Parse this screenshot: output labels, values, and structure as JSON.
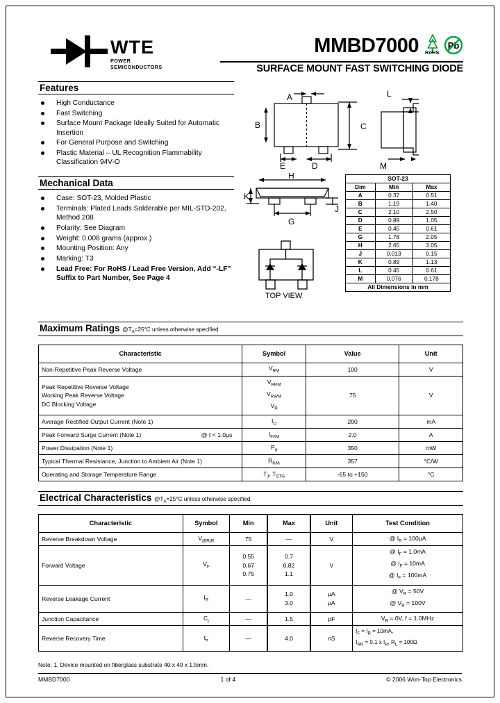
{
  "header": {
    "logo_text": "WTE",
    "logo_sub": "POWER SEMICONDUCTORS",
    "part_number": "MMBD7000",
    "rohs_label": "RoHS",
    "pb_label": "Pb",
    "subtitle": "SURFACE MOUNT FAST SWITCHING DIODE"
  },
  "features": {
    "title": "Features",
    "items": [
      "High Conductance",
      "Fast Switching",
      "Surface Mount Package Ideally Suited for Automatic Insertion",
      "For General Purpose and Switching",
      "Plastic Material – UL Recognition Flammability Classification 94V-O"
    ]
  },
  "mechanical": {
    "title": "Mechanical Data",
    "items": [
      "Case: SOT-23, Molded Plastic",
      "Terminals: Plated Leads Solderable per MIL-STD-202, Method 208",
      "Polarity: See Diagram",
      "Weight: 0.008 grams (approx.)",
      "Mounting Position: Any",
      "Marking: T3",
      "Lead Free: For RoHS / Lead Free Version, Add “-LF” Suffix to Part Number, See Page 4"
    ],
    "bold_index": 6
  },
  "package_diagram": {
    "labels": [
      "A",
      "B",
      "C",
      "D",
      "E",
      "G",
      "H",
      "J",
      "K",
      "L",
      "M"
    ],
    "top_view_label": "TOP VIEW"
  },
  "dim_table": {
    "title": "SOT-23",
    "columns": [
      "Dim",
      "Min",
      "Max"
    ],
    "rows": [
      {
        "dim": "A",
        "min": "0.37",
        "max": "0.51"
      },
      {
        "dim": "B",
        "min": "1.19",
        "max": "1.40"
      },
      {
        "dim": "C",
        "min": "2.10",
        "max": "2.50"
      },
      {
        "dim": "D",
        "min": "0.89",
        "max": "1.05"
      },
      {
        "dim": "E",
        "min": "0.45",
        "max": "0.61"
      },
      {
        "dim": "G",
        "min": "1.78",
        "max": "2.05"
      },
      {
        "dim": "H",
        "min": "2.65",
        "max": "3.05"
      },
      {
        "dim": "J",
        "min": "0.013",
        "max": "0.15"
      },
      {
        "dim": "K",
        "min": "0.89",
        "max": "1.13"
      },
      {
        "dim": "L",
        "min": "0.45",
        "max": "0.61"
      },
      {
        "dim": "M",
        "min": "0.076",
        "max": "0.178"
      }
    ],
    "footer": "All Dimensions in mm"
  },
  "max_ratings": {
    "title": "Maximum Ratings",
    "condition": "@TA=25°C unless otherwise specified",
    "columns": [
      "Characteristic",
      "Symbol",
      "Value",
      "Unit"
    ],
    "rows": [
      {
        "characteristic": "Non-Repetitive Peak Reverse Voltage",
        "symbol_html": "V<sub>RM</sub>",
        "value": "100",
        "unit": "V"
      },
      {
        "characteristic_lines": [
          "Peak Repetitive Reverse Voltage",
          "Working Peak Reverse Voltage",
          "DC Blocking Voltage"
        ],
        "symbol_lines_html": [
          "V<sub>RRM</sub>",
          "V<sub>RWM</sub>",
          "V<sub>R</sub>"
        ],
        "value": "75",
        "unit": "V"
      },
      {
        "characteristic": "Average Rectified Output Current (Note 1)",
        "symbol_html": "I<sub>O</sub>",
        "value": "200",
        "unit": "mA"
      },
      {
        "characteristic": "Peak Forward Surge Current (Note 1)",
        "inline_condition": "@ t < 1.0µs",
        "symbol_html": "I<sub>FSM</sub>",
        "value": "2.0",
        "unit": "A"
      },
      {
        "characteristic": "Power Dissipation (Note 1)",
        "symbol_html": "P<sub>d</sub>",
        "value": "350",
        "unit": "mW"
      },
      {
        "characteristic": "Typical Thermal Resistance, Junction to Ambient Air (Note 1)",
        "symbol_html": "R<sub>θJA</sub>",
        "value": "357",
        "unit": "°C/W"
      },
      {
        "characteristic": "Operating and Storage Temperature Range",
        "symbol_html": "T<sub>J</sub>, T<sub>STG</sub>",
        "value": "-65 to +150",
        "unit": "°C"
      }
    ]
  },
  "electrical": {
    "title": "Electrical Characteristics",
    "condition": "@TA=25°C unless otherwise specified",
    "columns": [
      "Characteristic",
      "Symbol",
      "Min",
      "Max",
      "Unit",
      "Test Condition"
    ],
    "rows": [
      {
        "characteristic": "Reverse Breakdown Voltage",
        "symbol_html": "V<sub>(BR)R</sub>",
        "min": "75",
        "max": "—",
        "unit": "V",
        "condition_html": "@ I<sub>R</sub> = 100µA"
      },
      {
        "characteristic": "Forward Voltage",
        "symbol_html": "V<sub>F</sub>",
        "min_lines": [
          "0.55",
          "0.67",
          "0.75"
        ],
        "max_lines": [
          "0.7",
          "0.82",
          "1.1"
        ],
        "unit": "V",
        "condition_lines_html": [
          "@ I<sub>F</sub> = 1.0mA",
          "@ I<sub>F</sub> = 10mA",
          "@ I<sub>F</sub> = 100mA"
        ]
      },
      {
        "characteristic": "Reverse Leakage Current",
        "symbol_html": "I<sub>R</sub>",
        "min": "—",
        "max_lines": [
          "1.0",
          "3.0"
        ],
        "unit_lines": [
          "µA",
          "µA"
        ],
        "condition_lines_html": [
          "@ V<sub>R</sub> = 50V",
          "@ V<sub>R</sub> = 100V"
        ]
      },
      {
        "characteristic": "Junction Capacitance",
        "symbol_html": "C<sub>j</sub>",
        "min": "—",
        "max": "1.5",
        "unit": "pF",
        "condition_html": "V<sub>R</sub> = 0V, f = 1.0MHz"
      },
      {
        "characteristic": "Reverse Recovery Time",
        "symbol_html": "t<sub>rr</sub>",
        "min": "—",
        "max": "4.0",
        "unit": "nS",
        "condition_lines_html": [
          "I<sub>F</sub> = I<sub>R</sub> = 10mA,",
          "I<sub>RR</sub> = 0.1 x I<sub>R</sub>, R<sub>L</sub> = 100Ω"
        ]
      }
    ]
  },
  "note": "Note:  1. Device mounted on fiberglass substrate 40 x 40 x 1.5mm.",
  "footer": {
    "left": "MMBD7000",
    "center": "1 of 4",
    "right": "© 2006 Won-Top Electronics"
  },
  "colors": {
    "rohs_green": "#00a13a",
    "text": "#000000"
  }
}
